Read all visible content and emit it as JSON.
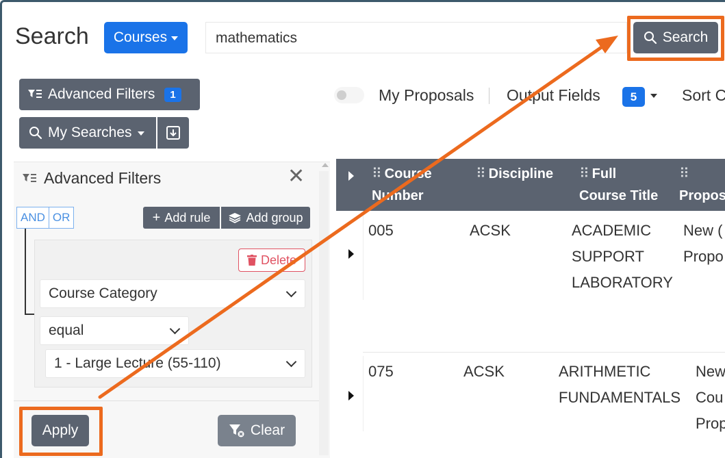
{
  "header": {
    "title": "Search",
    "category_button": "Courses",
    "search_value": "mathematics",
    "search_button": "Search"
  },
  "left_toolbar": {
    "advanced_filters_label": "Advanced Filters",
    "advanced_filters_count": "1",
    "my_searches_label": "My Searches"
  },
  "options": {
    "my_proposals_label": "My Proposals",
    "output_fields_label": "Output Fields",
    "output_fields_count": "5",
    "sort_label": "Sort C"
  },
  "filter_panel": {
    "title": "Advanced Filters",
    "and_label": "AND",
    "or_label": "OR",
    "add_rule_label": "Add rule",
    "add_group_label": "Add group",
    "delete_label": "Delete",
    "field_value": "Course Category",
    "operator_value": "equal",
    "value_value": "1 - Large Lecture (55-110)",
    "apply_label": "Apply",
    "clear_label": "Clear"
  },
  "table": {
    "columns": [
      {
        "line1": "Course",
        "line2": "Number"
      },
      {
        "line1": "Discipline",
        "line2": ""
      },
      {
        "line1": "Full",
        "line2": "Course Title"
      },
      {
        "line1": "",
        "line2": "Propos"
      }
    ],
    "rows": [
      {
        "number": "005",
        "discipline": "ACSK",
        "title_lines": [
          "ACADEMIC",
          "SUPPORT",
          "LABORATORY"
        ],
        "proposal_lines": [
          "New (",
          "Propo"
        ]
      },
      {
        "number": "075",
        "discipline": "ACSK",
        "title_lines": [
          "ARITHMETIC",
          "FUNDAMENTALS"
        ],
        "proposal_lines": [
          "New",
          "Cou",
          "Prop"
        ]
      }
    ]
  },
  "colors": {
    "primary_blue": "#1a73e8",
    "button_gray": "#5b6370",
    "highlight_orange": "#ec6a1e",
    "delete_red": "#e05262"
  }
}
